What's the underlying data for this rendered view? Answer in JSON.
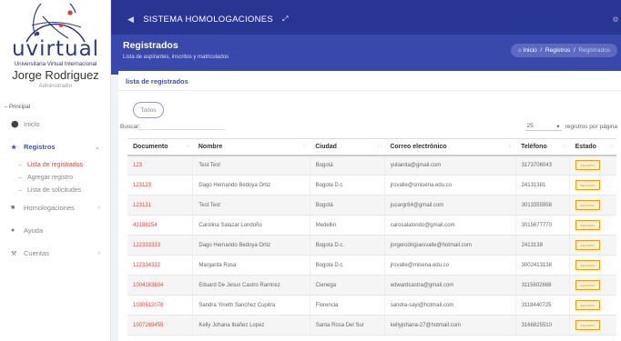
{
  "app": {
    "logo_text": "uvirtual",
    "logo_subtitle": "Universitaria Virtual Internacional",
    "title": "SISTEMA HOMOLOGACIONES"
  },
  "user": {
    "name": "Jorge Rodriguez",
    "role": "Administrador"
  },
  "sidebar": {
    "section": "Principal",
    "items": [
      {
        "label": "Inicio",
        "icon": "home-icon"
      },
      {
        "label": "Registros",
        "icon": "users-icon",
        "active": true,
        "sub": [
          "Lista de registrados",
          "Agregar registro",
          "Lista de solicitudes"
        ]
      },
      {
        "label": "Homologaciones",
        "icon": "book-icon"
      },
      {
        "label": "Ayuda",
        "icon": "help-icon"
      },
      {
        "label": "Cuentas",
        "icon": "wrench-icon"
      }
    ]
  },
  "header": {
    "title": "Registrados",
    "subtitle": "Lista de aspirantes, inscritos y matriculados",
    "breadcrumb": {
      "home": "Inicio",
      "level1": "Registros",
      "current": "Registrados"
    }
  },
  "panel": {
    "title": "lista de registrados",
    "filter_button": "Todos",
    "search_label": "Buscar:",
    "per_page_value": "25",
    "per_page_label": "registros por página"
  },
  "table": {
    "columns": [
      "Documento",
      "Nombre",
      "Ciudad",
      "Correo electrónico",
      "Teléfono",
      "Estado"
    ],
    "rows": [
      [
        "123",
        "Test Test",
        "Bogotá",
        "yulianita@gmail.com",
        "3173706043",
        "aspirante"
      ],
      [
        "123123",
        "Dago Hernando Bedoya Ortiz",
        "Bogota D.c.",
        "jrovalle@smiseria.edu.co",
        "24131381",
        "aspirante"
      ],
      [
        "123131",
        "Test Test",
        "Bogotá",
        "jucargr84@gmail.com",
        "3013355958",
        "aspirante"
      ],
      [
        "43188254",
        "Carolina Salazar Londoño",
        "Medellin",
        "carosalalondo@gmail.com",
        "3015677770",
        "aspirante"
      ],
      [
        "122333333",
        "Dago Hernando Bedoya Ortiz",
        "Bogota D.c.",
        "jorgerodriguesvalle@hotmail.com",
        "2413138",
        "aspirante"
      ],
      [
        "122334332",
        "Margarita Rosa",
        "Bogota D.c.",
        "jrovalle@misena.edu.co",
        "3002413138",
        "aspirante"
      ],
      [
        "1004163604",
        "Eduard De Jesus Castro Ramirez",
        "Cienega",
        "edwardcastra@gmail.com",
        "3115602668",
        "aspirante"
      ],
      [
        "1030512078",
        "Sandra Yineth Sanchez Cupitra",
        "Florencia",
        "sandra-sayi@hotmail.com",
        "3118440725",
        "aspirante"
      ],
      [
        "1007269455",
        "Kelly Johana Ibañez Lopez",
        "Santa Rosa Del Sur",
        "kellyjohana-27@hotmail.com",
        "3166825510",
        "aspirante"
      ]
    ]
  },
  "colors": {
    "topbar": "#283593",
    "header": "#3949ab",
    "accent": "#3f51b5",
    "doc_link": "#f44336",
    "badge": "#ff9800"
  }
}
